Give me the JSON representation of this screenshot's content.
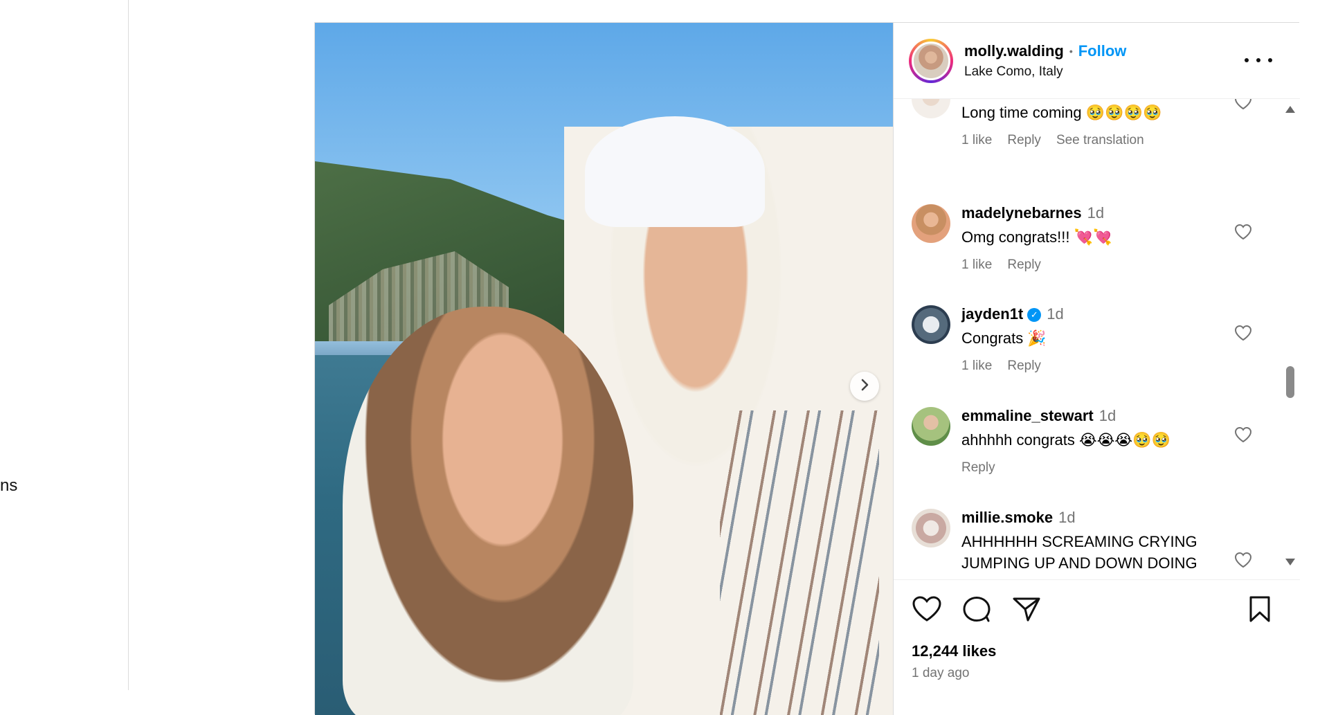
{
  "left_nav": {
    "fragment_text": "ns"
  },
  "post": {
    "author": {
      "username": "molly.walding",
      "separator": "•",
      "follow_label": "Follow",
      "location": "Lake Como, Italy"
    },
    "comments": [
      {
        "username": "",
        "time": "",
        "text": "Long time coming 🥹🥹🥹🥹",
        "likes": "1 like",
        "reply": "Reply",
        "extra": "See translation",
        "verified": false
      },
      {
        "username": "madelynebarnes",
        "time": "1d",
        "text": "Omg congrats!!! 💘💘",
        "likes": "1 like",
        "reply": "Reply",
        "extra": "",
        "verified": false
      },
      {
        "username": "jayden1t",
        "time": "1d",
        "text": "Congrats 🎉",
        "likes": "1 like",
        "reply": "Reply",
        "extra": "",
        "verified": true
      },
      {
        "username": "emmaline_stewart",
        "time": "1d",
        "text": "ahhhhh congrats 😭😭😭🥹🥹",
        "likes": "",
        "reply": "Reply",
        "extra": "",
        "verified": false
      },
      {
        "username": "millie.smoke",
        "time": "1d",
        "text": "AHHHHHH SCREAMING CRYING JUMPING UP AND DOWN DOING",
        "likes": "",
        "reply": "",
        "extra": "",
        "verified": false
      }
    ],
    "likes_count": "12,244 likes",
    "posted_ago": "1 day ago",
    "icons": [
      "heart-icon",
      "comment-icon",
      "share-icon",
      "bookmark-icon",
      "more-icon",
      "chevron-right-icon"
    ]
  }
}
